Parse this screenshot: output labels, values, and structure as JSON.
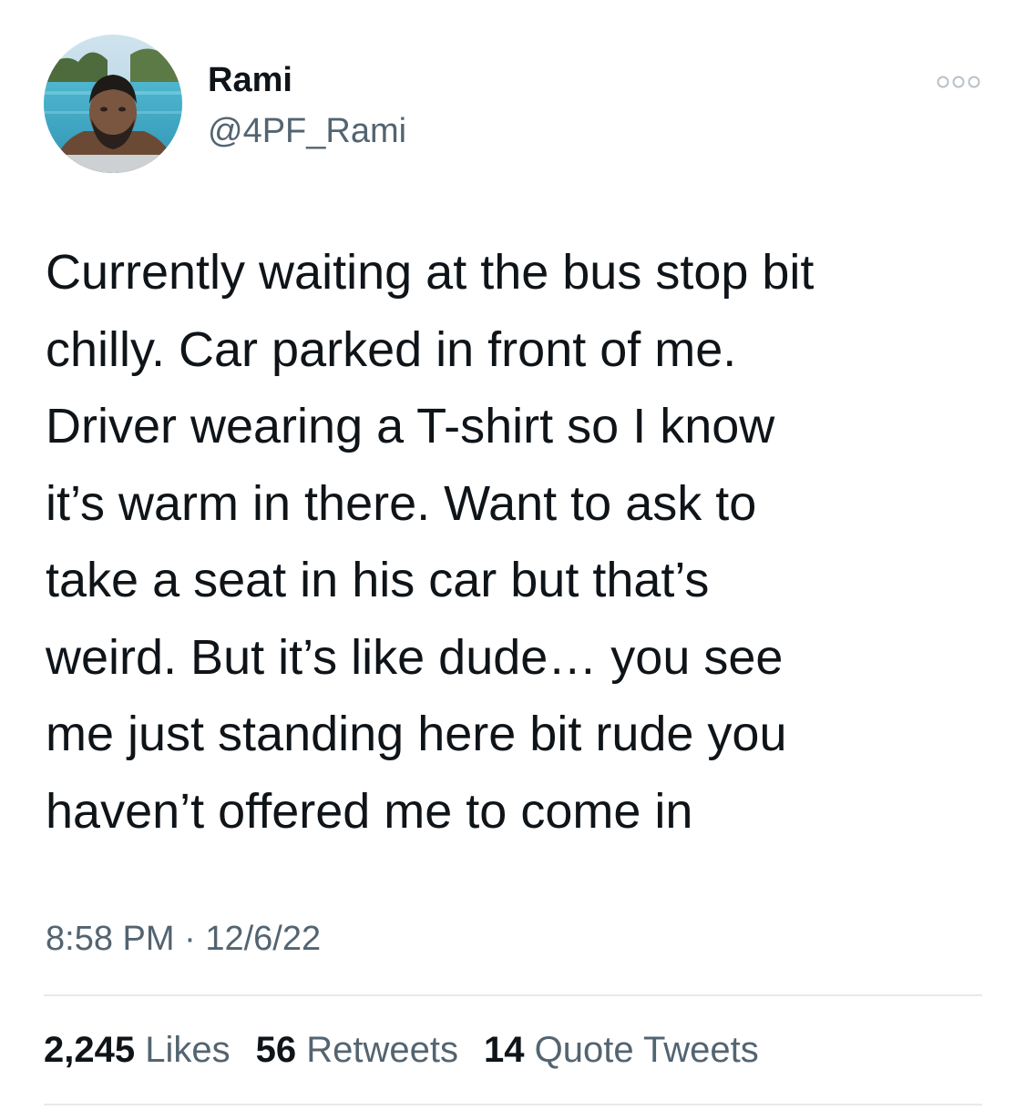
{
  "tweet": {
    "author": {
      "display_name": "Rami",
      "handle": "@4PF_Rami"
    },
    "text": "Currently waiting at the bus stop bit\nchilly. Car parked in front of me.\nDriver wearing a T-shirt so I know\nit’s warm in there. Want to ask to\ntake a seat in his car but that’s\nweird. But it’s like dude… you see\nme just standing here bit rude you\nhaven’t offered me to come in",
    "time": "8:58 PM",
    "separator": "·",
    "date": "12/6/22",
    "stats": {
      "likes_count": "2,245",
      "likes_label": "Likes",
      "retweets_count": "56",
      "retweets_label": "Retweets",
      "quotes_count": "14",
      "quotes_label": "Quote Tweets"
    }
  },
  "icons": {
    "more": "more-horizontal-icon"
  },
  "colors": {
    "text_primary": "#0f1419",
    "text_secondary": "#536471",
    "divider": "#e7e9ea",
    "more_icon": "#b9c1c8"
  }
}
